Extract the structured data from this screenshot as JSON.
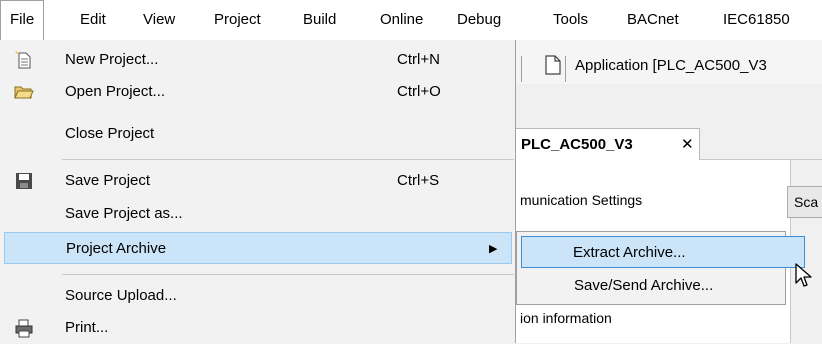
{
  "menubar": {
    "items": [
      {
        "label": "File",
        "active": true
      },
      {
        "label": "Edit"
      },
      {
        "label": "View"
      },
      {
        "label": "Project"
      },
      {
        "label": "Build"
      },
      {
        "label": "Online"
      },
      {
        "label": "Debug"
      },
      {
        "label": "Tools"
      },
      {
        "label": "BACnet"
      },
      {
        "label": "IEC61850"
      }
    ]
  },
  "background": {
    "application_label": "Application [PLC_AC500_V3",
    "tab_label": "PLC_AC500_V3",
    "tab_close": "✕",
    "communication_label": "munication Settings",
    "scan_button_label": "Sca",
    "information_label": "ion information"
  },
  "file_menu": {
    "items": [
      {
        "label": "New Project...",
        "shortcut": "Ctrl+N",
        "icon": "new-project-icon"
      },
      {
        "label": "Open Project...",
        "shortcut": "Ctrl+O",
        "icon": "open-folder-icon"
      },
      {
        "label": "Close Project",
        "shortcut": ""
      },
      {
        "label": "Save Project",
        "shortcut": "Ctrl+S",
        "icon": "save-disk-icon"
      },
      {
        "label": "Save Project as...",
        "shortcut": ""
      },
      {
        "label": "Project Archive",
        "submenu_arrow": "▶",
        "highlighted": true
      },
      {
        "label": "Source Upload...",
        "shortcut": ""
      },
      {
        "label": "Print...",
        "shortcut": "",
        "icon": "printer-icon"
      }
    ]
  },
  "archive_submenu": {
    "items": [
      {
        "label": "Extract Archive...",
        "highlighted": true
      },
      {
        "label": "Save/Send Archive..."
      }
    ]
  },
  "colors": {
    "menu_highlight": "#cce4f7",
    "submenu_highlight_border": "#3c8fd6",
    "menu_background": "#f2f2f2"
  }
}
